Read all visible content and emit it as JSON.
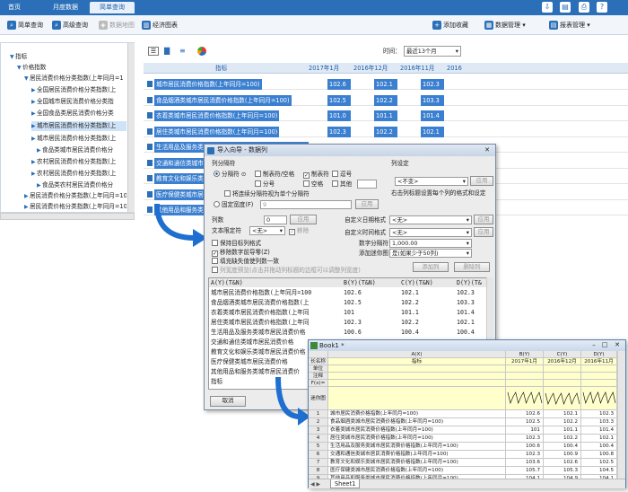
{
  "topbar": {
    "tabs": [
      {
        "label": "首页"
      },
      {
        "label": "月度数据"
      },
      {
        "label": "简单查询"
      }
    ]
  },
  "toolbar": {
    "items": [
      {
        "label": "简单查询"
      },
      {
        "label": "高级查询"
      },
      {
        "label": "数据地图"
      },
      {
        "label": "经济图表"
      }
    ],
    "right": [
      {
        "label": "添加收藏"
      },
      {
        "label": "数据管理"
      },
      {
        "label": "报表管理"
      }
    ]
  },
  "sidebar": {
    "items": [
      {
        "label": "指标"
      },
      {
        "label": "价格指数"
      },
      {
        "label": "居民消费价格分类指数(上年同月=1"
      },
      {
        "label": "全国居民消费价格分类指数(上"
      },
      {
        "label": "全国城市居民消费价格分类指"
      },
      {
        "label": "全国食品类居民消费价格分类"
      },
      {
        "label": "城市居民消费价格分类指数(上"
      },
      {
        "label": "城市居民消费价格分类指数(上"
      },
      {
        "label": "食品类城市居民消费价格分"
      },
      {
        "label": "农村居民消费价格分类指数(上"
      },
      {
        "label": "农村居民消费价格分类指数(上"
      },
      {
        "label": "食品类农村居民消费价格分"
      },
      {
        "label": "居民消费价格分类指数(上年同月=100)"
      },
      {
        "label": "居民消费价格分类指数(上年同月=10"
      }
    ]
  },
  "view": {
    "time_label": "时间：",
    "time_value": "最近13个月"
  },
  "grid": {
    "headers": [
      "指标",
      "2017年1月",
      "2016年12月",
      "2016年11月",
      "2016"
    ],
    "rows": [
      {
        "name": "城市居民消费价格指数(上年同月=100)",
        "v": [
          "102.6",
          "102.1",
          "102.3"
        ]
      },
      {
        "name": "食品烟酒类城市居民消费价格指数(上年同月=100)",
        "v": [
          "102.5",
          "102.2",
          "103.3"
        ]
      },
      {
        "name": "衣着类城市居民消费价格指数(上年同月=100)",
        "v": [
          "101.0",
          "101.1",
          "101.4"
        ]
      },
      {
        "name": "居住类城市居民消费价格指数(上年同月=100)",
        "v": [
          "102.3",
          "102.2",
          "102.1"
        ]
      },
      {
        "name": "生活用品及服务类城市居民消费价格指数(上年同月=100)",
        "v": [
          "",
          "",
          ""
        ]
      },
      {
        "name": "交通和通信类城市居民",
        "v": [
          "",
          "",
          ""
        ]
      },
      {
        "name": "教育文化和娱乐类城市",
        "v": [
          "",
          "",
          ""
        ]
      },
      {
        "name": "医疗保健类城市居民",
        "v": [
          "",
          "",
          ""
        ]
      },
      {
        "name": "其他用品和服务类城市",
        "v": [
          "",
          "",
          ""
        ]
      }
    ]
  },
  "dialog": {
    "title": "导入向导 - 数据列",
    "sep_group": "列分隔符",
    "sep_radio": "分隔符",
    "sep_options": [
      "制表符/空格",
      "制表符",
      "逗号",
      "分号",
      "空格",
      "其他"
    ],
    "sep_merge": "将连续分隔符视为单个分隔符",
    "fixed": "固定宽度(F)",
    "fixed_value": "9",
    "apply": "应用",
    "col_settings": "列设定",
    "col_select": "<不变>",
    "col_hint": "右击列标题设置每个列的格式和设定",
    "col_count_label": "列数",
    "col_count_value": "0",
    "text_qual_label": "文本限定符",
    "text_qual_value": "<无>",
    "remove_label": "移除",
    "date_label": "自定义日期格式",
    "date_value": "<无>",
    "time_label": "自定义时间格式",
    "time_value": "<无>",
    "num_sep_label": "数字分隔符",
    "num_sep_value": "1,000.00",
    "sparkline_label": "添加迷你图",
    "sparkline_value": "是(如果少于50列)",
    "opt1": "保持目标列格式",
    "opt2": "移除数字前导零(Z)",
    "opt3": "填充缺失值使列数一致",
    "opt4": "列宽度预览(点击并拖动列标题的边框可以调整列宽度)",
    "add_col": "添加列",
    "del_col": "删除列",
    "preview_header": [
      "A(Y)(T&N)",
      "B(Y)(T&N)",
      "C(Y)(T&N)",
      "D(Y)(T&"
    ],
    "preview_rows": [
      [
        "城市居民消费价格指数(上年同月=100",
        "102.6",
        "102.1",
        "102.3"
      ],
      [
        "食品烟酒类城市居民消费价格指数(上",
        "102.5",
        "102.2",
        "103.3"
      ],
      [
        "衣着类城市居民消费价格指数(上年同",
        "101",
        "101.1",
        "101.4"
      ],
      [
        "居住类城市居民消费价格指数(上年同",
        "102.3",
        "102.2",
        "102.1"
      ],
      [
        "生活用品及服务类城市居民消费价格",
        "100.6",
        "100.4",
        "100.4"
      ],
      [
        "交通和通信类城市居民消费价格",
        "",
        " ",
        ""
      ],
      [
        "教育文化和娱乐类城市居民消费价格",
        "",
        "",
        ""
      ],
      [
        "医疗保健类城市居民消费价格",
        "",
        "",
        ""
      ],
      [
        "其他用品和服务类城市居民消费价",
        "",
        "",
        ""
      ],
      [
        "指标",
        "",
        "",
        ""
      ]
    ],
    "cancel": "取消"
  },
  "book": {
    "title": "Book1 *",
    "col_headers": [
      "A(X)",
      "B(Y)",
      "C(Y)",
      "D(Y)"
    ],
    "meta_rows": [
      "长名称",
      "单位",
      "注释",
      "F(x)=",
      "迷你图"
    ],
    "long_names": [
      "指标",
      "2017年1月",
      "2016年12月",
      "2016年11月"
    ],
    "rows": [
      {
        "n": "1",
        "a": "城市居民消费价格指数(上年同月=100)",
        "b": "102.6",
        "c": "102.1",
        "d": "102.3"
      },
      {
        "n": "2",
        "a": "食品烟酒类城市居民消费价格指数(上年同月=100)",
        "b": "102.5",
        "c": "102.2",
        "d": "103.3"
      },
      {
        "n": "3",
        "a": "衣着类城市居民消费价格指数(上年同月=100)",
        "b": "101",
        "c": "101.1",
        "d": "101.4"
      },
      {
        "n": "4",
        "a": "居住类城市居民消费价格指数(上年同月=100)",
        "b": "102.3",
        "c": "102.2",
        "d": "102.1"
      },
      {
        "n": "5",
        "a": "生活用品及服务类城市居民消费价格指数(上年同月=100)",
        "b": "100.6",
        "c": "100.4",
        "d": "100.4"
      },
      {
        "n": "6",
        "a": "交通和通信类城市居民消费价格指数(上年同月=100)",
        "b": "102.3",
        "c": "100.9",
        "d": "100.8"
      },
      {
        "n": "7",
        "a": "教育文化和娱乐类城市居民消费价格指数(上年同月=100)",
        "b": "103.6",
        "c": "102.6",
        "d": "102.5"
      },
      {
        "n": "8",
        "a": "医疗保健类城市居民消费价格指数(上年同月=100)",
        "b": "105.7",
        "c": "105.3",
        "d": "104.5"
      },
      {
        "n": "9",
        "a": "其他用品和服务类城市居民消费价格指数(上年同月=100)",
        "b": "104.1",
        "c": "104.9",
        "d": "104.1"
      }
    ],
    "sheet": "Sheet1"
  }
}
